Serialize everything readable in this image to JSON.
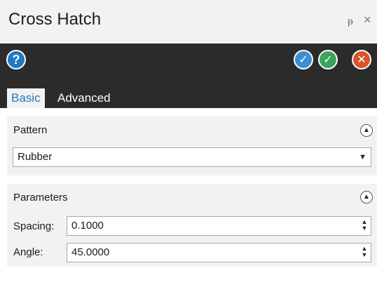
{
  "window": {
    "title": "Cross Hatch",
    "pin_glyph": "ᵽ",
    "close_glyph": "×"
  },
  "toolbar": {
    "help_glyph": "?",
    "apply_glyph": "✓",
    "ok_glyph": "✓",
    "cancel_glyph": "✕"
  },
  "tabs": [
    {
      "label": "Basic",
      "active": true
    },
    {
      "label": "Advanced",
      "active": false
    }
  ],
  "pattern": {
    "label": "Pattern",
    "selected": "Rubber"
  },
  "parameters": {
    "label": "Parameters",
    "spacing_label": "Spacing:",
    "spacing_value": "0.1000",
    "angle_label": "Angle:",
    "angle_value": "45.0000"
  },
  "colors": {
    "accent": "#1f78c1",
    "toolbar_bg": "#2b2b2b",
    "ok": "#3aa35c",
    "cancel": "#d9532c"
  }
}
